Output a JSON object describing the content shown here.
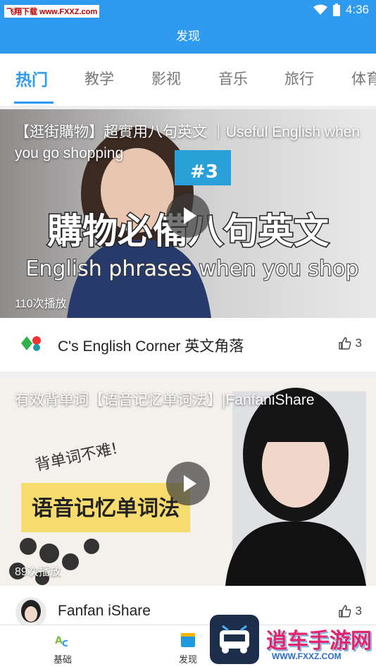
{
  "status_bar": {
    "watermark": "飞翔下载 www.FXXZ.com",
    "time": "4:36",
    "icons": [
      "wifi-icon",
      "battery-icon"
    ]
  },
  "header": {
    "title": "发现"
  },
  "tabs": [
    {
      "label": "热门",
      "active": true
    },
    {
      "label": "教学",
      "active": false
    },
    {
      "label": "影视",
      "active": false
    },
    {
      "label": "音乐",
      "active": false
    },
    {
      "label": "旅行",
      "active": false
    },
    {
      "label": "体育",
      "active": false
    }
  ],
  "videos": [
    {
      "title": "【逛街購物】超實用八句英文 ｜Useful English when you go shopping",
      "thumbnail_text": [
        "購物必備八句英文",
        "English phrases when you shop",
        "#3"
      ],
      "plays": "110次播放",
      "channel": "C's English Corner 英文角落",
      "likes": "3"
    },
    {
      "title": "有效背单词【语音记忆单词法】|FanfaniShare",
      "thumbnail_text": [
        "背单词不难!",
        "语音记忆单词法"
      ],
      "plays": "89次播放",
      "channel": "Fanfan iShare",
      "likes": "3"
    }
  ],
  "bottom_nav": [
    {
      "label": "基础",
      "icon": "abc-icon"
    },
    {
      "label": "发现",
      "icon": "book-icon"
    }
  ],
  "corner_watermark": {
    "text": "逍车手游网",
    "sub": "WWW.FXXZ.COM"
  },
  "colors": {
    "primary": "#2f9bf0",
    "like": "#444444"
  }
}
